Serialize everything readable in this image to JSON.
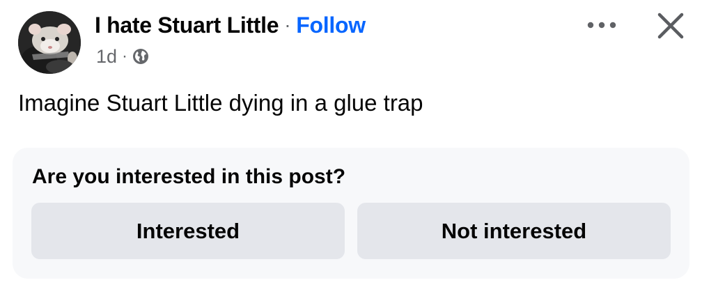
{
  "post": {
    "author": "I hate Stuart Little",
    "separator": "·",
    "follow_label": "Follow",
    "timestamp": "1d",
    "meta_separator": "·",
    "audience_icon": "globe-icon",
    "more_icon": "more-horizontal-icon",
    "close_icon": "close-icon",
    "text": "Imagine Stuart Little dying in a glue trap"
  },
  "interest_prompt": {
    "question": "Are you interested in this post?",
    "interested_label": "Interested",
    "not_interested_label": "Not interested"
  },
  "colors": {
    "link": "#0866ff",
    "secondary_text": "#65676b",
    "primary_text": "#050505",
    "card_background": "#f7f8fa",
    "button_background": "#e4e6eb"
  }
}
